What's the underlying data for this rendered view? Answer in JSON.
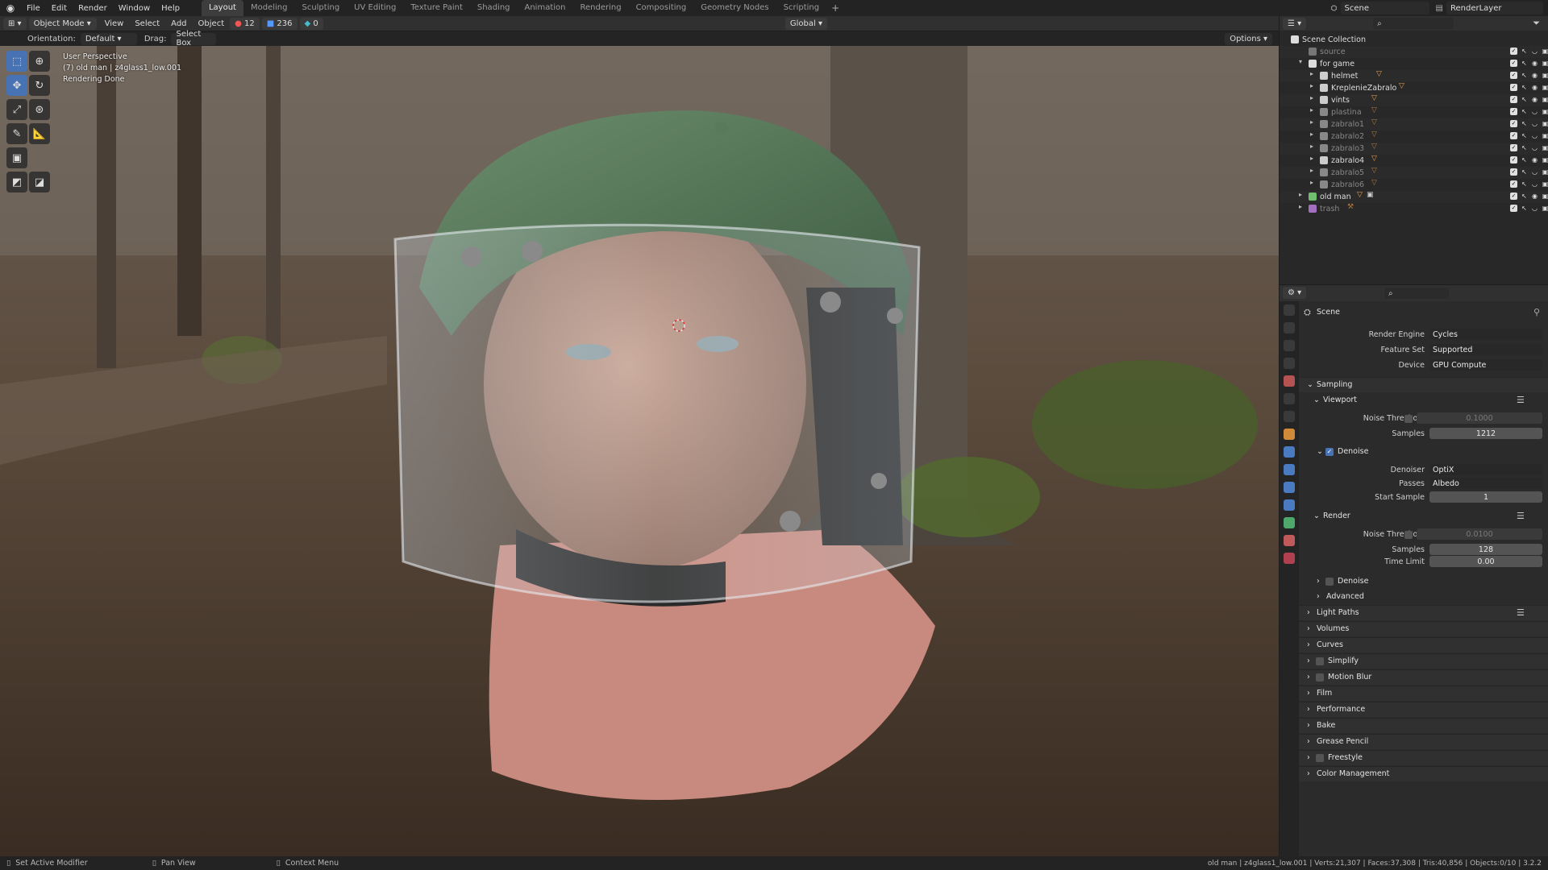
{
  "menu": [
    "File",
    "Edit",
    "Render",
    "Window",
    "Help"
  ],
  "workspaces": [
    "Layout",
    "Modeling",
    "Sculpting",
    "UV Editing",
    "Texture Paint",
    "Shading",
    "Animation",
    "Rendering",
    "Compositing",
    "Geometry Nodes",
    "Scripting"
  ],
  "active_workspace": "Layout",
  "topright": {
    "scene": "Scene",
    "view_layer": "RenderLayer"
  },
  "viewport_header": {
    "mode": "Object Mode",
    "menus": [
      "View",
      "Select",
      "Add",
      "Object"
    ],
    "count_a": "12",
    "count_b": "236",
    "count_c": "0",
    "transform": "Global"
  },
  "tool_options": {
    "orientation_label": "Orientation:",
    "orientation": "Default",
    "drag_label": "Drag:",
    "drag": "Select Box",
    "options": "Options"
  },
  "viewport_overlay": {
    "line1": "User Perspective",
    "line2": "(7) old man | z4glass1_low.001",
    "line3": "Rendering Done"
  },
  "outliner": {
    "root": "Scene Collection",
    "rows": [
      {
        "name": "source",
        "dim": true
      },
      {
        "name": "for game",
        "dim": false
      },
      {
        "name": "helmet",
        "dim": false
      },
      {
        "name": "KreplenieZabralo",
        "dim": false
      },
      {
        "name": "vints",
        "dim": false
      },
      {
        "name": "plastina",
        "dim": true
      },
      {
        "name": "zabralo1",
        "dim": true
      },
      {
        "name": "zabralo2",
        "dim": true
      },
      {
        "name": "zabralo3",
        "dim": true
      },
      {
        "name": "zabralo4",
        "dim": false
      },
      {
        "name": "zabralo5",
        "dim": true
      },
      {
        "name": "zabralo6",
        "dim": true
      },
      {
        "name": "old man",
        "dim": false
      },
      {
        "name": "trash",
        "dim": true
      }
    ]
  },
  "properties": {
    "context": "Scene",
    "render_engine_label": "Render Engine",
    "render_engine": "Cycles",
    "feature_set_label": "Feature Set",
    "feature_set": "Supported",
    "device_label": "Device",
    "device": "GPU Compute",
    "sampling": "Sampling",
    "viewport": "Viewport",
    "noise_threshold_label": "Noise Threshold",
    "viewport_noise_threshold": "0.1000",
    "samples_label": "Samples",
    "viewport_samples": "1212",
    "denoise": "Denoise",
    "denoiser_label": "Denoiser",
    "denoiser": "OptiX",
    "passes_label": "Passes",
    "passes": "Albedo",
    "start_sample_label": "Start Sample",
    "start_sample": "1",
    "render": "Render",
    "render_noise_threshold": "0.0100",
    "render_samples": "128",
    "time_limit_label": "Time Limit",
    "time_limit": "0.00",
    "render_denoise": "Denoise",
    "advanced": "Advanced",
    "panels": [
      "Light Paths",
      "Volumes",
      "Curves",
      "Simplify",
      "Motion Blur",
      "Film",
      "Performance",
      "Bake",
      "Grease Pencil",
      "Freestyle",
      "Color Management"
    ]
  },
  "status": {
    "left1": "Set Active Modifier",
    "left2": "Pan View",
    "left3": "Context Menu",
    "right": "old man | z4glass1_low.001 | Verts:21,307 | Faces:37,308 | Tris:40,856 | Objects:0/10 | 3.2.2"
  }
}
